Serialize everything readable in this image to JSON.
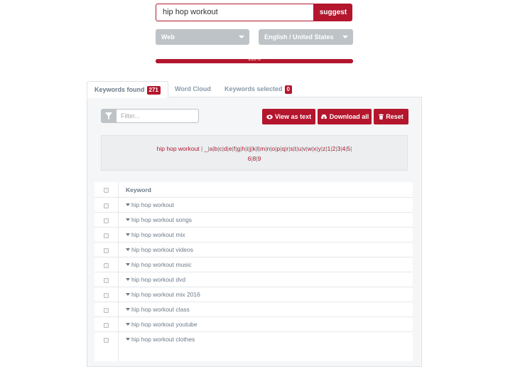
{
  "search": {
    "value": "hip hop workout",
    "button_label": "suggest"
  },
  "filters": {
    "source": "Web",
    "language": "English / United States"
  },
  "progress": {
    "value": 1.0,
    "label": "100%"
  },
  "tabs": [
    {
      "label": "Keywords found",
      "badge": "271"
    },
    {
      "label": "Word Cloud"
    },
    {
      "label": "Keywords selected",
      "badge": "0"
    }
  ],
  "toolbar": {
    "filter_placeholder": "Filter...",
    "view_as_text": "View as text",
    "download_all": "Download all",
    "reset": "Reset"
  },
  "alphabet": {
    "query": "hip hop workout",
    "links": [
      "_",
      "a",
      "b",
      "c",
      "d",
      "e",
      "f",
      "g",
      "h",
      "i",
      "j",
      "k",
      "l",
      "m",
      "n",
      "o",
      "p",
      "q",
      "r",
      "s",
      "t",
      "u",
      "v",
      "w",
      "x",
      "y",
      "z",
      "1",
      "2",
      "3",
      "4",
      "5",
      "6",
      "8",
      "9"
    ]
  },
  "table": {
    "header": "Keyword",
    "rows": [
      "hip hop workout",
      "hip hop workout songs",
      "hip hop workout mix",
      "hip hop workout videos",
      "hip hop workout music",
      "hip hop workout dvd",
      "hip hop workout mix 2016",
      "hip hop workout class",
      "hip hop workout youtube",
      "hip hop workout clothes"
    ]
  },
  "colors": {
    "accent": "#b3162d",
    "select_bg": "#bdc3c7",
    "panel_bg": "#f5f6f7",
    "text": "#6c7a89"
  },
  "icons": {
    "filter": "funnel-icon",
    "view": "eye-icon",
    "download": "cloud-download-icon",
    "reset": "trash-icon"
  }
}
